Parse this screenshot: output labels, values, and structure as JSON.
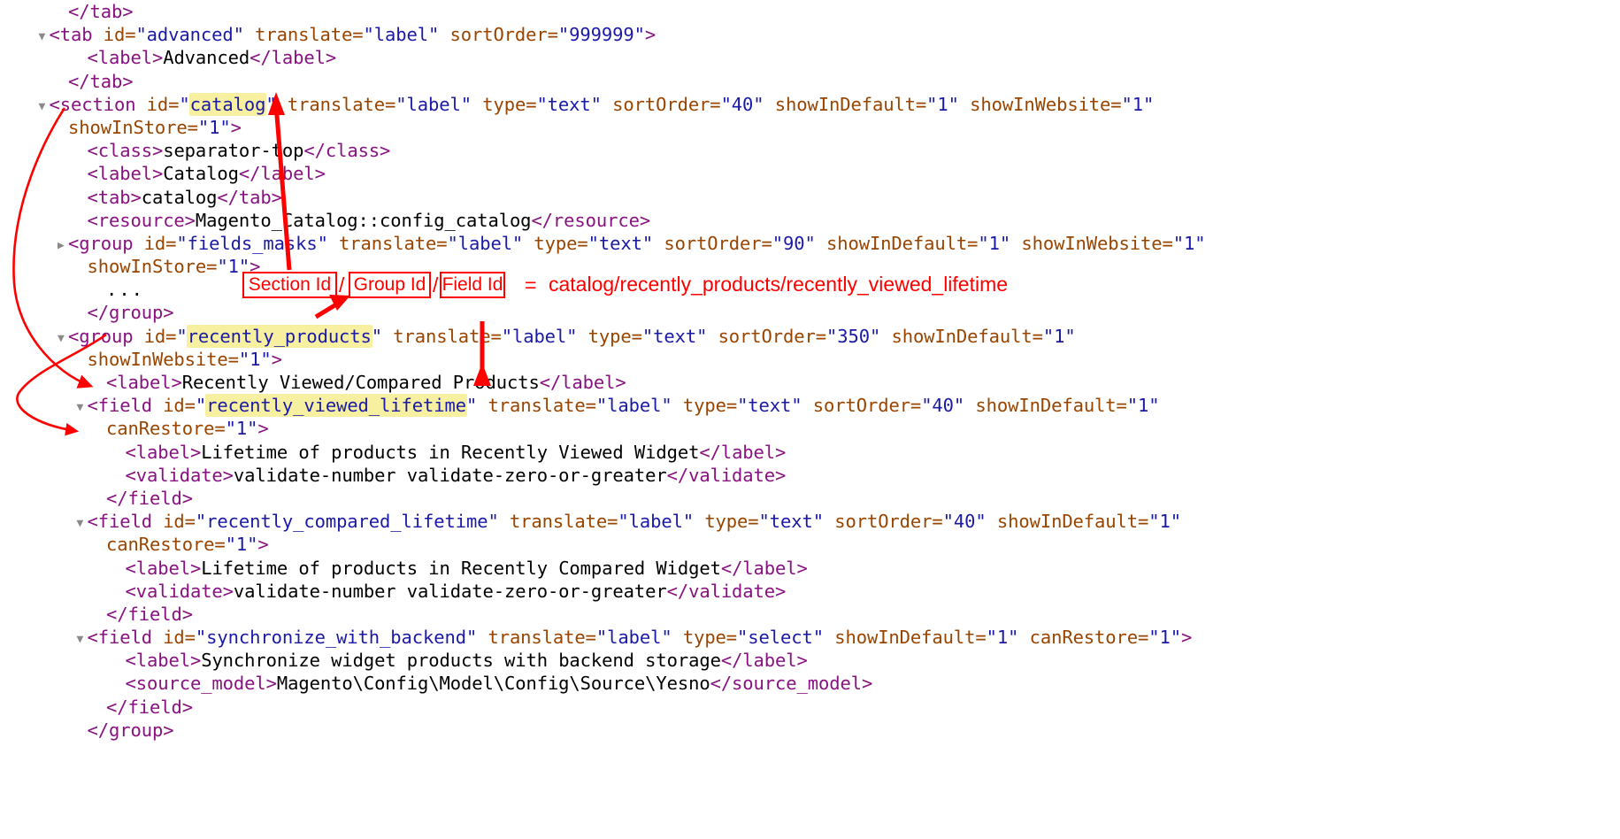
{
  "view": {
    "type": "xml-source-viewer",
    "filename_context": "Magento system.xml",
    "background_color": "#ffffff",
    "syntax_colors": {
      "tag": "#881280",
      "attribute_name": "#994500",
      "attribute_value": "#1a1aa6",
      "text_node": "#000000",
      "highlight": "#f7f0a0",
      "annotation": "#ff0000",
      "triangle": "#8a8a8a"
    }
  },
  "annotations": {
    "box_section_id": "Section Id",
    "box_group_id": "Group Id",
    "box_field_id": "Field Id",
    "separator_1": "/",
    "separator_2": "/",
    "equals": "=",
    "path_value": "catalog/recently_products/recently_viewed_lifetime"
  },
  "code_lines": [
    {
      "id": "line-1",
      "indent": 2,
      "triangle": "blank",
      "tokens": [
        {
          "t": "tg",
          "v": "</tab>"
        }
      ]
    },
    {
      "id": "line-2",
      "indent": 1,
      "triangle": "open",
      "tokens": [
        {
          "t": "tg",
          "v": "<tab"
        },
        {
          "t": "an",
          "v": " id="
        },
        {
          "t": "av",
          "v": "\"advanced\""
        },
        {
          "t": "an",
          "v": " translate="
        },
        {
          "t": "av",
          "v": "\"label\""
        },
        {
          "t": "an",
          "v": " sortOrder="
        },
        {
          "t": "av",
          "v": "\"999999\""
        },
        {
          "t": "tg",
          "v": ">"
        }
      ]
    },
    {
      "id": "line-3",
      "indent": 3,
      "triangle": "blank",
      "tokens": [
        {
          "t": "tg",
          "v": "<label>"
        },
        {
          "t": "txt",
          "v": "Advanced"
        },
        {
          "t": "tg",
          "v": "</label>"
        }
      ]
    },
    {
      "id": "line-4",
      "indent": 2,
      "triangle": "blank",
      "tokens": [
        {
          "t": "tg",
          "v": "</tab>"
        }
      ]
    },
    {
      "id": "line-5",
      "indent": 1,
      "triangle": "open",
      "tokens": [
        {
          "t": "tg",
          "v": "<section"
        },
        {
          "t": "an",
          "v": " id="
        },
        {
          "t": "av",
          "v": "\""
        },
        {
          "t": "av hl",
          "v": "catalog"
        },
        {
          "t": "av",
          "v": "\""
        },
        {
          "t": "an",
          "v": " translate="
        },
        {
          "t": "av",
          "v": "\"label\""
        },
        {
          "t": "an",
          "v": " type="
        },
        {
          "t": "av",
          "v": "\"text\""
        },
        {
          "t": "an",
          "v": " sortOrder="
        },
        {
          "t": "av",
          "v": "\"40\""
        },
        {
          "t": "an",
          "v": " showInDefault="
        },
        {
          "t": "av",
          "v": "\"1\""
        },
        {
          "t": "an",
          "v": " showInWebsite="
        },
        {
          "t": "av",
          "v": "\"1\""
        }
      ]
    },
    {
      "id": "line-6",
      "indent": 2,
      "triangle": "blank",
      "tokens": [
        {
          "t": "an",
          "v": "showInStore="
        },
        {
          "t": "av",
          "v": "\"1\""
        },
        {
          "t": "tg",
          "v": ">"
        }
      ]
    },
    {
      "id": "line-7",
      "indent": 3,
      "triangle": "blank",
      "tokens": [
        {
          "t": "tg",
          "v": "<class>"
        },
        {
          "t": "txt",
          "v": "separator-top"
        },
        {
          "t": "tg",
          "v": "</class>"
        }
      ]
    },
    {
      "id": "line-8",
      "indent": 3,
      "triangle": "blank",
      "tokens": [
        {
          "t": "tg",
          "v": "<label>"
        },
        {
          "t": "txt",
          "v": "Catalog"
        },
        {
          "t": "tg",
          "v": "</label>"
        }
      ]
    },
    {
      "id": "line-9",
      "indent": 3,
      "triangle": "blank",
      "tokens": [
        {
          "t": "tg",
          "v": "<tab>"
        },
        {
          "t": "txt",
          "v": "catalog"
        },
        {
          "t": "tg",
          "v": "</tab>"
        }
      ]
    },
    {
      "id": "line-10",
      "indent": 3,
      "triangle": "blank",
      "tokens": [
        {
          "t": "tg",
          "v": "<resource>"
        },
        {
          "t": "txt",
          "v": "Magento_Catalog::config_catalog"
        },
        {
          "t": "tg",
          "v": "</resource>"
        }
      ]
    },
    {
      "id": "line-11",
      "indent": 2,
      "triangle": "closed",
      "tokens": [
        {
          "t": "tg",
          "v": "<group"
        },
        {
          "t": "an",
          "v": " id="
        },
        {
          "t": "av",
          "v": "\"fields_masks\""
        },
        {
          "t": "an",
          "v": " translate="
        },
        {
          "t": "av",
          "v": "\"label\""
        },
        {
          "t": "an",
          "v": " type="
        },
        {
          "t": "av",
          "v": "\"text\""
        },
        {
          "t": "an",
          "v": " sortOrder="
        },
        {
          "t": "av",
          "v": "\"90\""
        },
        {
          "t": "an",
          "v": " showInDefault="
        },
        {
          "t": "av",
          "v": "\"1\""
        },
        {
          "t": "an",
          "v": " showInWebsite="
        },
        {
          "t": "av",
          "v": "\"1\""
        }
      ]
    },
    {
      "id": "line-12",
      "indent": 3,
      "triangle": "blank",
      "tokens": [
        {
          "t": "an",
          "v": "showInStore="
        },
        {
          "t": "av",
          "v": "\"1\""
        },
        {
          "t": "tg",
          "v": ">"
        }
      ]
    },
    {
      "id": "line-13",
      "indent": 4,
      "triangle": "blank",
      "tokens": [
        {
          "t": "dots",
          "v": "..."
        }
      ]
    },
    {
      "id": "line-14",
      "indent": 3,
      "triangle": "blank",
      "tokens": [
        {
          "t": "tg",
          "v": "</group>"
        }
      ]
    },
    {
      "id": "line-15",
      "indent": 2,
      "triangle": "open",
      "tokens": [
        {
          "t": "tg",
          "v": "<group"
        },
        {
          "t": "an",
          "v": " id="
        },
        {
          "t": "av",
          "v": "\""
        },
        {
          "t": "av hl",
          "v": "recently_products"
        },
        {
          "t": "av",
          "v": "\""
        },
        {
          "t": "an",
          "v": " translate="
        },
        {
          "t": "av",
          "v": "\"label\""
        },
        {
          "t": "an",
          "v": " type="
        },
        {
          "t": "av",
          "v": "\"text\""
        },
        {
          "t": "an",
          "v": " sortOrder="
        },
        {
          "t": "av",
          "v": "\"350\""
        },
        {
          "t": "an",
          "v": " showInDefault="
        },
        {
          "t": "av",
          "v": "\"1\""
        }
      ]
    },
    {
      "id": "line-16",
      "indent": 3,
      "triangle": "blank",
      "tokens": [
        {
          "t": "an",
          "v": "showInWebsite="
        },
        {
          "t": "av",
          "v": "\"1\""
        },
        {
          "t": "tg",
          "v": ">"
        }
      ]
    },
    {
      "id": "line-17",
      "indent": 4,
      "triangle": "blank",
      "tokens": [
        {
          "t": "tg",
          "v": "<label>"
        },
        {
          "t": "txt",
          "v": "Recently Viewed/Compared Products"
        },
        {
          "t": "tg",
          "v": "</label>"
        }
      ]
    },
    {
      "id": "line-18",
      "indent": 3,
      "triangle": "open",
      "tokens": [
        {
          "t": "tg",
          "v": "<field"
        },
        {
          "t": "an",
          "v": " id="
        },
        {
          "t": "av",
          "v": "\""
        },
        {
          "t": "av hl",
          "v": "recently_viewed_lifetime"
        },
        {
          "t": "av",
          "v": "\""
        },
        {
          "t": "an",
          "v": " translate="
        },
        {
          "t": "av",
          "v": "\"label\""
        },
        {
          "t": "an",
          "v": " type="
        },
        {
          "t": "av",
          "v": "\"text\""
        },
        {
          "t": "an",
          "v": " sortOrder="
        },
        {
          "t": "av",
          "v": "\"40\""
        },
        {
          "t": "an",
          "v": " showInDefault="
        },
        {
          "t": "av",
          "v": "\"1\""
        }
      ]
    },
    {
      "id": "line-19",
      "indent": 4,
      "triangle": "blank",
      "tokens": [
        {
          "t": "an",
          "v": "canRestore="
        },
        {
          "t": "av",
          "v": "\"1\""
        },
        {
          "t": "tg",
          "v": ">"
        }
      ]
    },
    {
      "id": "line-20",
      "indent": 5,
      "triangle": "blank",
      "tokens": [
        {
          "t": "tg",
          "v": "<label>"
        },
        {
          "t": "txt",
          "v": "Lifetime of products in Recently Viewed Widget"
        },
        {
          "t": "tg",
          "v": "</label>"
        }
      ]
    },
    {
      "id": "line-21",
      "indent": 5,
      "triangle": "blank",
      "tokens": [
        {
          "t": "tg",
          "v": "<validate>"
        },
        {
          "t": "txt",
          "v": "validate-number validate-zero-or-greater"
        },
        {
          "t": "tg",
          "v": "</validate>"
        }
      ]
    },
    {
      "id": "line-22",
      "indent": 4,
      "triangle": "blank",
      "tokens": [
        {
          "t": "tg",
          "v": "</field>"
        }
      ]
    },
    {
      "id": "line-23",
      "indent": 3,
      "triangle": "open",
      "tokens": [
        {
          "t": "tg",
          "v": "<field"
        },
        {
          "t": "an",
          "v": " id="
        },
        {
          "t": "av",
          "v": "\"recently_compared_lifetime\""
        },
        {
          "t": "an",
          "v": " translate="
        },
        {
          "t": "av",
          "v": "\"label\""
        },
        {
          "t": "an",
          "v": " type="
        },
        {
          "t": "av",
          "v": "\"text\""
        },
        {
          "t": "an",
          "v": " sortOrder="
        },
        {
          "t": "av",
          "v": "\"40\""
        },
        {
          "t": "an",
          "v": " showInDefault="
        },
        {
          "t": "av",
          "v": "\"1\""
        }
      ]
    },
    {
      "id": "line-24",
      "indent": 4,
      "triangle": "blank",
      "tokens": [
        {
          "t": "an",
          "v": "canRestore="
        },
        {
          "t": "av",
          "v": "\"1\""
        },
        {
          "t": "tg",
          "v": ">"
        }
      ]
    },
    {
      "id": "line-25",
      "indent": 5,
      "triangle": "blank",
      "tokens": [
        {
          "t": "tg",
          "v": "<label>"
        },
        {
          "t": "txt",
          "v": "Lifetime of products in Recently Compared Widget"
        },
        {
          "t": "tg",
          "v": "</label>"
        }
      ]
    },
    {
      "id": "line-26",
      "indent": 5,
      "triangle": "blank",
      "tokens": [
        {
          "t": "tg",
          "v": "<validate>"
        },
        {
          "t": "txt",
          "v": "validate-number validate-zero-or-greater"
        },
        {
          "t": "tg",
          "v": "</validate>"
        }
      ]
    },
    {
      "id": "line-27",
      "indent": 4,
      "triangle": "blank",
      "tokens": [
        {
          "t": "tg",
          "v": "</field>"
        }
      ]
    },
    {
      "id": "line-28",
      "indent": 3,
      "triangle": "open",
      "tokens": [
        {
          "t": "tg",
          "v": "<field"
        },
        {
          "t": "an",
          "v": " id="
        },
        {
          "t": "av",
          "v": "\"synchronize_with_backend\""
        },
        {
          "t": "an",
          "v": " translate="
        },
        {
          "t": "av",
          "v": "\"label\""
        },
        {
          "t": "an",
          "v": " type="
        },
        {
          "t": "av",
          "v": "\"select\""
        },
        {
          "t": "an",
          "v": " showInDefault="
        },
        {
          "t": "av",
          "v": "\"1\""
        },
        {
          "t": "an",
          "v": " canRestore="
        },
        {
          "t": "av",
          "v": "\"1\""
        },
        {
          "t": "tg",
          "v": ">"
        }
      ]
    },
    {
      "id": "line-29",
      "indent": 5,
      "triangle": "blank",
      "tokens": [
        {
          "t": "tg",
          "v": "<label>"
        },
        {
          "t": "txt",
          "v": "Synchronize widget products with backend storage"
        },
        {
          "t": "tg",
          "v": "</label>"
        }
      ]
    },
    {
      "id": "line-30",
      "indent": 5,
      "triangle": "blank",
      "tokens": [
        {
          "t": "tg",
          "v": "<source_model>"
        },
        {
          "t": "txt",
          "v": "Magento\\Config\\Model\\Config\\Source\\Yesno"
        },
        {
          "t": "tg",
          "v": "</source_model>"
        }
      ]
    },
    {
      "id": "line-31",
      "indent": 4,
      "triangle": "blank",
      "tokens": [
        {
          "t": "tg",
          "v": "</field>"
        }
      ]
    },
    {
      "id": "line-32",
      "indent": 3,
      "triangle": "blank",
      "tokens": [
        {
          "t": "tg",
          "v": "</group>"
        }
      ]
    }
  ]
}
